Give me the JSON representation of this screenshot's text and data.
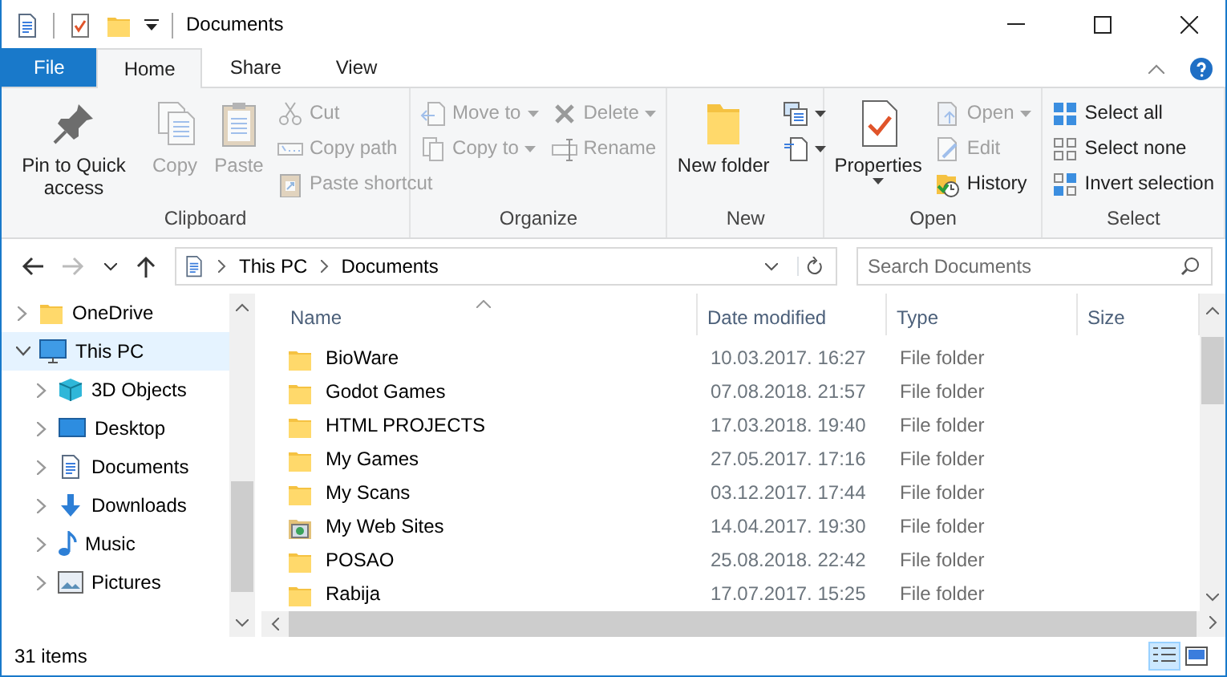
{
  "window": {
    "title": "Documents"
  },
  "ribbon_tabs": [
    {
      "label": "File",
      "kind": "menu",
      "selected": false
    },
    {
      "label": "Home",
      "kind": "tab",
      "selected": true
    },
    {
      "label": "Share",
      "kind": "tab",
      "selected": false
    },
    {
      "label": "View",
      "kind": "tab",
      "selected": false
    }
  ],
  "ribbon_groups": [
    {
      "label": "Clipboard",
      "items": [
        {
          "kind": "large",
          "label": "Pin to Quick access",
          "disabled": false
        },
        {
          "kind": "large",
          "label": "Copy",
          "disabled": true
        },
        {
          "kind": "large",
          "label": "Paste",
          "disabled": true
        },
        {
          "kind": "stack",
          "items": [
            {
              "label": "Cut",
              "disabled": true
            },
            {
              "label": "Copy path",
              "disabled": true
            },
            {
              "label": "Paste shortcut",
              "disabled": true
            }
          ]
        }
      ]
    },
    {
      "label": "Organize",
      "items": [
        {
          "kind": "stack",
          "items": [
            {
              "label": "Move to",
              "disabled": true,
              "dropdown": true
            },
            {
              "label": "Copy to",
              "disabled": true,
              "dropdown": true
            }
          ]
        },
        {
          "kind": "stack",
          "items": [
            {
              "label": "Delete",
              "disabled": true,
              "dropdown": true
            },
            {
              "label": "Rename",
              "disabled": true
            }
          ]
        }
      ]
    },
    {
      "label": "New",
      "items": [
        {
          "kind": "large",
          "label": "New folder",
          "disabled": false
        },
        {
          "kind": "stack",
          "items": [
            {
              "disabled": false,
              "dropdown": true
            },
            {
              "disabled": false,
              "dropdown": true
            }
          ]
        }
      ]
    },
    {
      "label": "Open",
      "items": [
        {
          "kind": "large",
          "label": "Properties",
          "disabled": false,
          "dropdown": true
        },
        {
          "kind": "stack",
          "items": [
            {
              "label": "Open",
              "disabled": true,
              "dropdown": true
            },
            {
              "label": "Edit",
              "disabled": true
            },
            {
              "label": "History",
              "disabled": false
            }
          ]
        }
      ]
    },
    {
      "label": "Select",
      "items": [
        {
          "kind": "stack",
          "items": [
            {
              "label": "Select all",
              "disabled": false
            },
            {
              "label": "Select none",
              "disabled": false
            },
            {
              "label": "Invert selection",
              "disabled": false
            }
          ]
        }
      ]
    }
  ],
  "nav_buttons": [
    {
      "kind": "back",
      "disabled": false
    },
    {
      "kind": "forward",
      "disabled": true
    },
    {
      "kind": "recent",
      "disabled": false
    },
    {
      "kind": "up",
      "disabled": false
    }
  ],
  "address": {
    "breadcrumb": [
      "This PC",
      "Documents"
    ]
  },
  "search": {
    "placeholder": "Search Documents"
  },
  "tree": [
    {
      "label": "OneDrive",
      "expanded": false,
      "selected": false
    },
    {
      "label": "This PC",
      "expanded": true,
      "selected": true,
      "children": [
        {
          "label": "3D Objects",
          "expanded": false,
          "selected": false
        },
        {
          "label": "Desktop",
          "expanded": false,
          "selected": false
        },
        {
          "label": "Documents",
          "expanded": false,
          "selected": false
        },
        {
          "label": "Downloads",
          "expanded": false,
          "selected": false
        },
        {
          "label": "Music",
          "expanded": false,
          "selected": false
        },
        {
          "label": "Pictures",
          "expanded": false,
          "selected": false
        }
      ]
    }
  ],
  "columns": [
    {
      "label": "Name",
      "sorted": true
    },
    {
      "label": "Date modified",
      "sorted": false
    },
    {
      "label": "Type",
      "sorted": false
    },
    {
      "label": "Size",
      "sorted": false
    }
  ],
  "files": [
    {
      "name": "BioWare",
      "date": "10.03.2017. 16:27",
      "type": "File folder",
      "kind": "folder"
    },
    {
      "name": "Godot Games",
      "date": "07.08.2018. 21:57",
      "type": "File folder",
      "kind": "folder"
    },
    {
      "name": "HTML PROJECTS",
      "date": "17.03.2018. 19:40",
      "type": "File folder",
      "kind": "folder"
    },
    {
      "name": "My Games",
      "date": "27.05.2017. 17:16",
      "type": "File folder",
      "kind": "folder"
    },
    {
      "name": "My Scans",
      "date": "03.12.2017. 17:44",
      "type": "File folder",
      "kind": "folder"
    },
    {
      "name": "My Web Sites",
      "date": "14.04.2017. 19:30",
      "type": "File folder",
      "kind": "special"
    },
    {
      "name": "POSAO",
      "date": "25.08.2018. 22:42",
      "type": "File folder",
      "kind": "folder"
    },
    {
      "name": "Rabija",
      "date": "17.07.2017. 15:25",
      "type": "File folder",
      "kind": "folder"
    }
  ],
  "status_bar": {
    "count": "31 items"
  },
  "view_modes": [
    {
      "kind": "details",
      "selected": true
    },
    {
      "kind": "large-icons",
      "selected": false
    }
  ]
}
